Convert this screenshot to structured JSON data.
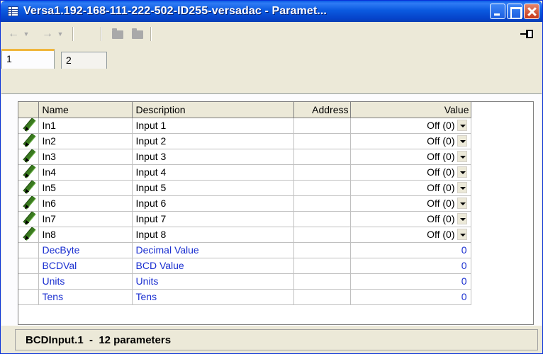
{
  "window": {
    "title": "Versa1.192-168-111-222-502-ID255-versadac - Paramet..."
  },
  "toolbar": {
    "back_symbol": "←",
    "forward_symbol": "→",
    "caret_symbol": "▼",
    "icons": [
      "back-arrow-icon",
      "forward-arrow-icon",
      "folder-icon",
      "folder-icon",
      "pin-icon"
    ]
  },
  "tabs": [
    {
      "label": "1"
    },
    {
      "label": "2"
    }
  ],
  "grid": {
    "columns": {
      "name": "Name",
      "description": "Description",
      "address": "Address",
      "value": "Value"
    },
    "rows": [
      {
        "name": "In1",
        "description": "Input 1",
        "address": "",
        "value": "Off (0)"
      },
      {
        "name": "In2",
        "description": "Input 2",
        "address": "",
        "value": "Off (0)"
      },
      {
        "name": "In3",
        "description": "Input 3",
        "address": "",
        "value": "Off (0)"
      },
      {
        "name": "In4",
        "description": "Input 4",
        "address": "",
        "value": "Off (0)"
      },
      {
        "name": "In5",
        "description": "Input 5",
        "address": "",
        "value": "Off (0)"
      },
      {
        "name": "In6",
        "description": "Input 6",
        "address": "",
        "value": "Off (0)"
      },
      {
        "name": "In7",
        "description": "Input 7",
        "address": "",
        "value": "Off (0)"
      },
      {
        "name": "In8",
        "description": "Input 8",
        "address": "",
        "value": "Off (0)"
      },
      {
        "name": "DecByte",
        "description": "Decimal Value",
        "address": "",
        "value": "0"
      },
      {
        "name": "BCDVal",
        "description": "BCD Value",
        "address": "",
        "value": "0"
      },
      {
        "name": "Units",
        "description": "Units",
        "address": "",
        "value": "0"
      },
      {
        "name": "Tens",
        "description": "Tens",
        "address": "",
        "value": "0"
      }
    ]
  },
  "status": {
    "text": "BCDInput.1  -  12 parameters"
  },
  "colors": {
    "titlebar": "#0a5de6",
    "readonly_text": "#1a2fd0",
    "tab_highlight": "#f0b63c"
  }
}
